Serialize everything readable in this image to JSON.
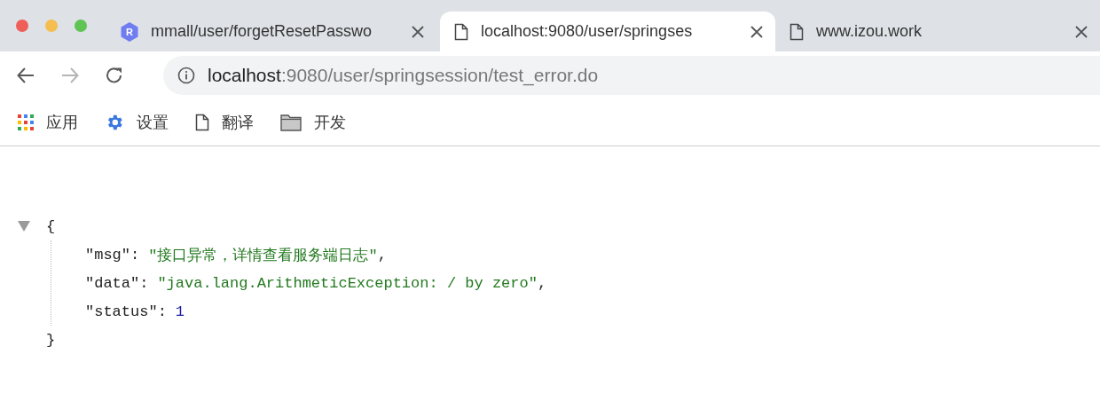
{
  "tabs": [
    {
      "kind": "logo",
      "icon_text": "R",
      "label": "mmall/user/forgetResetPasswo",
      "selected": false
    },
    {
      "kind": "page",
      "label": "localhost:9080/user/springses",
      "selected": true
    },
    {
      "kind": "page",
      "label": "www.izou.work",
      "selected": false
    }
  ],
  "nav": [
    {
      "kind": "back",
      "disabled": false
    },
    {
      "kind": "forward",
      "disabled": true
    },
    {
      "kind": "reload",
      "disabled": false
    }
  ],
  "address": {
    "host": "localhost",
    "path": ":9080/user/springsession/test_error.do"
  },
  "bookmarks": [
    {
      "kind": "apps",
      "label": "应用"
    },
    {
      "kind": "gear",
      "label": "设置"
    },
    {
      "kind": "page",
      "label": "翻译"
    },
    {
      "kind": "folder",
      "label": "开发"
    }
  ],
  "json_view": {
    "expanded": true,
    "open": "{",
    "close": "}",
    "lines": [
      {
        "key": "\"msg\"",
        "colon": ":",
        "value": "\"接口异常，详情查看服务端日志\"",
        "kind": "string",
        "comma": ","
      },
      {
        "key": "\"data\"",
        "colon": ":",
        "value": "\"java.lang.ArithmeticException: / by zero\"",
        "kind": "string",
        "comma": ","
      },
      {
        "key": "\"status\"",
        "colon": ":",
        "value": "1",
        "kind": "number"
      }
    ]
  }
}
